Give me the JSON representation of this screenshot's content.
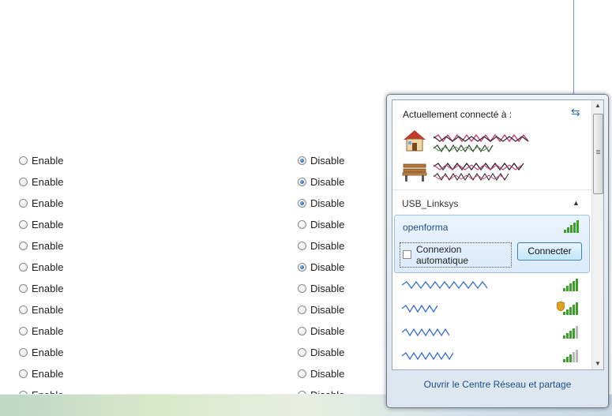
{
  "form": {
    "rows": [
      {
        "enable_label": "Enable",
        "disable_label": "Disable",
        "selected": "disable"
      },
      {
        "enable_label": "Enable",
        "disable_label": "Disable",
        "selected": "disable"
      },
      {
        "enable_label": "Enable",
        "disable_label": "Disable",
        "selected": "disable"
      },
      {
        "enable_label": "Enable",
        "disable_label": "Disable",
        "selected": "none"
      },
      {
        "enable_label": "Enable",
        "disable_label": "Disable",
        "selected": "none"
      },
      {
        "enable_label": "Enable",
        "disable_label": "Disable",
        "selected": "disable"
      },
      {
        "enable_label": "Enable",
        "disable_label": "Disable",
        "selected": "none"
      },
      {
        "enable_label": "Enable",
        "disable_label": "Disable",
        "selected": "none"
      },
      {
        "enable_label": "Enable",
        "disable_label": "Disable",
        "selected": "none"
      },
      {
        "enable_label": "Enable",
        "disable_label": "Disable",
        "selected": "none"
      },
      {
        "enable_label": "Enable",
        "disable_label": "Disable",
        "selected": "none"
      },
      {
        "enable_label": "Enable",
        "disable_label": "Disable",
        "selected": "none"
      }
    ]
  },
  "network_flyout": {
    "header": "Actuellement connecté à :",
    "refresh_icon": "refresh-arrows-icon",
    "connected": [
      {
        "icon": "home-network-icon"
      },
      {
        "icon": "public-network-bench-icon"
      }
    ],
    "group_name": "USB_Linksys",
    "selected_network": {
      "name": "openforma",
      "auto_connect_label": "Connexion automatique",
      "auto_connect_checked": false,
      "connect_button": "Connecter",
      "signal_bars": 5
    },
    "other_networks": [
      {
        "signal_bars": 5,
        "secured": false
      },
      {
        "signal_bars": 5,
        "secured": true
      },
      {
        "signal_bars": 4,
        "secured": false
      },
      {
        "signal_bars": 3,
        "secured": false
      }
    ],
    "footer_link": "Ouvrir le Centre Réseau et partage"
  },
  "colors": {
    "link": "#1a4e8f",
    "signal_green": "#3aa02a",
    "selection_bg": "#dbebfb"
  }
}
